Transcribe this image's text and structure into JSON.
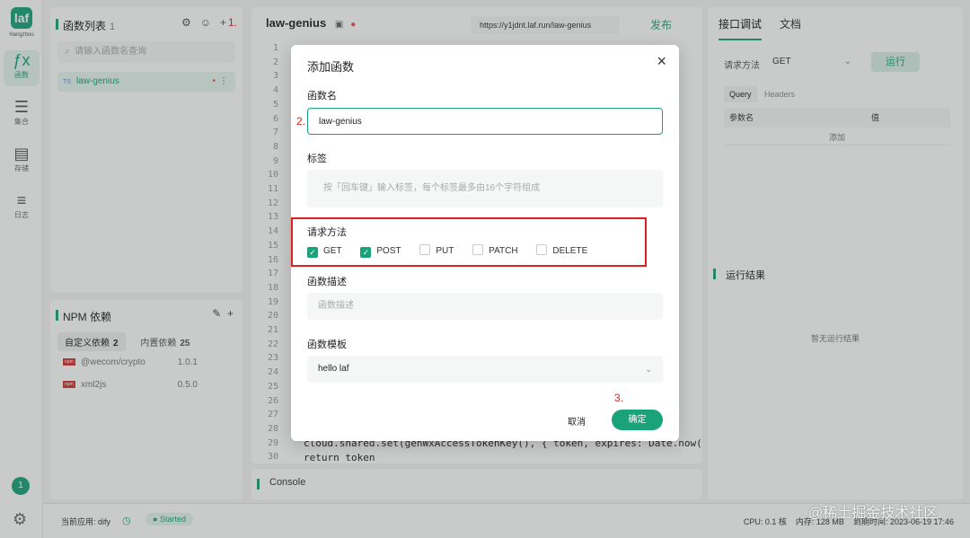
{
  "nav": {
    "logo_text": "laf",
    "logo_label": "Hangzhou",
    "items": [
      {
        "icon": "function-icon",
        "glyph": "ƒx",
        "label": "函数"
      },
      {
        "icon": "database-icon",
        "glyph": "☰",
        "label": "集合"
      },
      {
        "icon": "storage-icon",
        "glyph": "▤",
        "label": "存储"
      },
      {
        "icon": "log-icon",
        "glyph": "≡",
        "label": "日志"
      }
    ],
    "badge": "1"
  },
  "functions": {
    "title": "函数列表",
    "count": "1",
    "step1": "1.",
    "search_placeholder": "请输入函数名查询",
    "items": [
      {
        "lang": "TS",
        "name": "law-genius"
      }
    ]
  },
  "npm": {
    "title": "NPM 依赖",
    "tab_custom": "自定义依赖",
    "tab_custom_count": "2",
    "tab_builtin": "内置依赖",
    "tab_builtin_count": "25",
    "packages": [
      {
        "name": "@wecom/crypto",
        "version": "1.0.1"
      },
      {
        "name": "xml2js",
        "version": "0.5.0"
      }
    ]
  },
  "editor": {
    "title": "law-genius",
    "url": "https://y1jdnt.laf.run/law-genius",
    "publish": "发布",
    "line_numbers": [
      "1",
      "2",
      "3",
      "4",
      "5",
      "6",
      "7",
      "8",
      "9",
      "10",
      "11",
      "12",
      "13",
      "14",
      "15",
      "16",
      "17",
      "18",
      "19",
      "20",
      "21",
      "22",
      "23",
      "24",
      "25",
      "26",
      "27",
      "28",
      "29",
      "30"
    ],
    "code_lines": [
      "cloud.shared.set(genWxAccessTokenKey(), { token, expires: Date.now(",
      "return token"
    ]
  },
  "console": {
    "title": "Console"
  },
  "debug": {
    "tab_api": "接口调试",
    "tab_docs": "文档",
    "method_label": "请求方法",
    "method_value": "GET",
    "run": "运行",
    "query_tab": "Query",
    "headers_tab": "Headers",
    "col_name": "参数名",
    "col_value": "值",
    "add": "添加",
    "result_title": "运行结果",
    "no_result": "暂无运行结果"
  },
  "status": {
    "app": "当前应用: dify",
    "state": "Started",
    "cpu": "CPU: 0.1 核",
    "mem": "内存: 128 MB",
    "expire": "到期时间: 2023-06-19 17:46"
  },
  "modal": {
    "title": "添加函数",
    "name_label": "函数名",
    "name_value": "law-genius",
    "step2": "2.",
    "tags_label": "标签",
    "tags_placeholder": "按「回车键」输入标签，每个标签最多由16个字符组成",
    "method_label": "请求方法",
    "methods": [
      {
        "label": "GET",
        "checked": true
      },
      {
        "label": "POST",
        "checked": true
      },
      {
        "label": "PUT",
        "checked": false
      },
      {
        "label": "PATCH",
        "checked": false
      },
      {
        "label": "DELETE",
        "checked": false
      }
    ],
    "desc_label": "函数描述",
    "desc_placeholder": "函数描述",
    "template_label": "函数模板",
    "template_value": "hello laf",
    "step3": "3.",
    "cancel": "取消",
    "confirm": "确定"
  },
  "watermark": "@稀土掘金技术社区",
  "colors": {
    "accent": "#1aa37a",
    "annotation": "#e02020"
  }
}
